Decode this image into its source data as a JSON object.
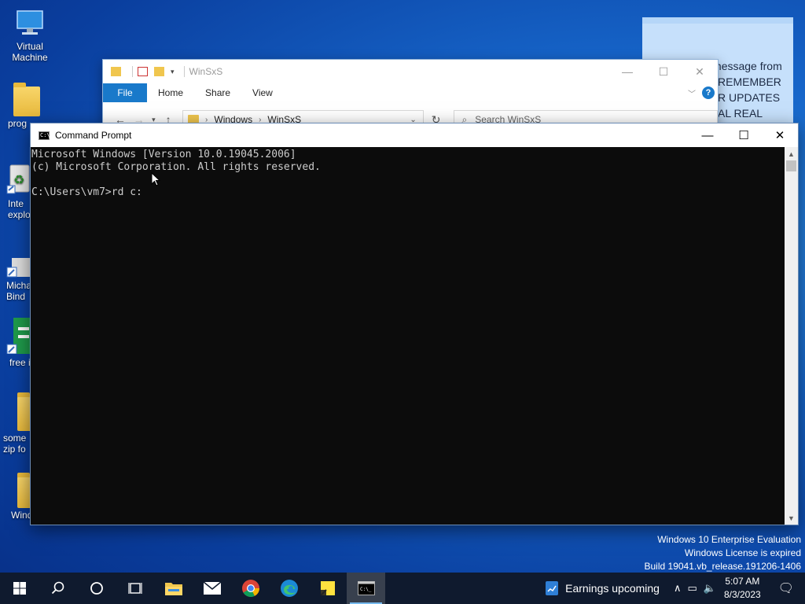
{
  "desktop": {
    "icons": [
      {
        "label": "Virtual\nMachine"
      },
      {
        "label": "prog"
      },
      {
        "label": "Inte\nexplo"
      },
      {
        "label": "Micha\nBind"
      },
      {
        "label": "free i"
      },
      {
        "label": "some\nzip fo"
      },
      {
        "label": "Wind"
      }
    ]
  },
  "sticky_note": {
    "lines": [
      "hello, this is message from",
      "REMEMBER",
      "R UPDATES",
      "AL REAL"
    ]
  },
  "explorer": {
    "title": "WinSxS",
    "ribbon_tabs": [
      "File",
      "Home",
      "Share",
      "View"
    ],
    "breadcrumb": [
      "Windows",
      "WinSxS"
    ],
    "search_placeholder": "Search WinSxS"
  },
  "cmd": {
    "title": "Command Prompt",
    "lines": [
      "Microsoft Windows [Version 10.0.19045.2006]",
      "(c) Microsoft Corporation. All rights reserved.",
      "",
      "C:\\Users\\vm7>rd c:"
    ]
  },
  "watermark": {
    "line1": "Windows 10 Enterprise Evaluation",
    "line2": "Windows License is expired",
    "line3": "Build 19041.vb_release.191206-1406"
  },
  "taskbar": {
    "news_text": "Earnings upcoming",
    "time": "5:07 AM",
    "date": "8/3/2023"
  },
  "colors": {
    "accent": "#1979ca",
    "console_bg": "#0c0c0c",
    "console_fg": "#cccccc"
  }
}
